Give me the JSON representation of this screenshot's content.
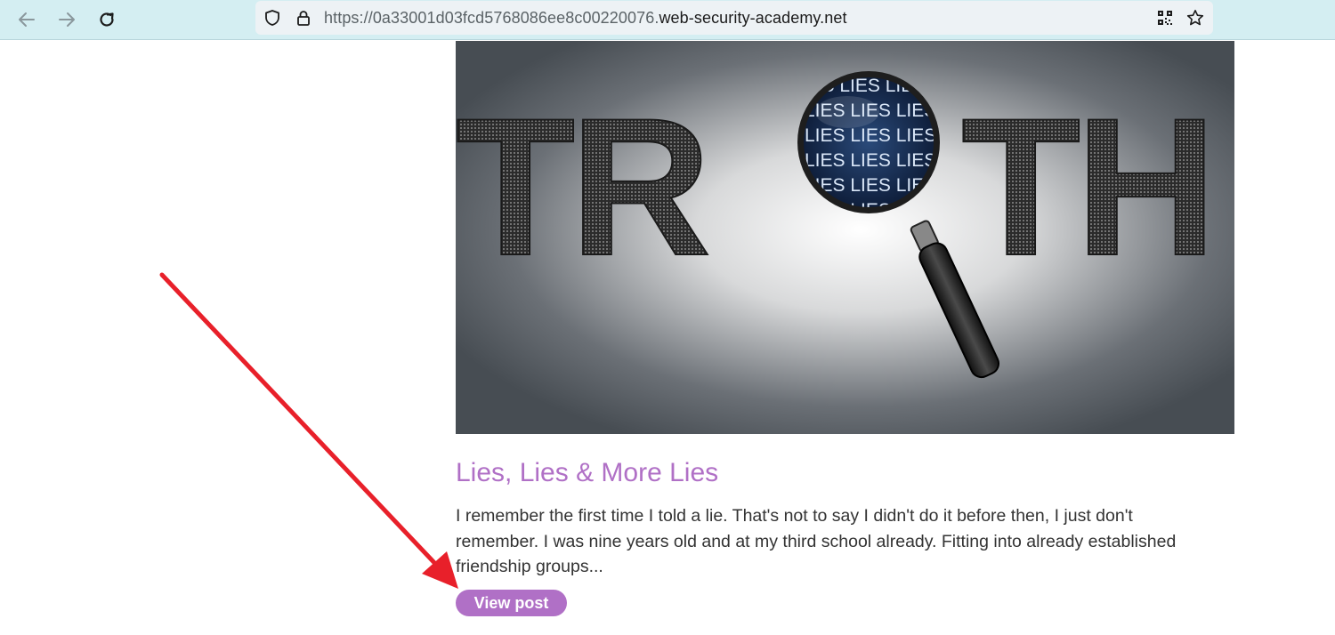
{
  "browser": {
    "url_prefix": "https://0a33001d03fcd5768086ee8c00220076.",
    "url_host": "web-security-academy.net"
  },
  "hero": {
    "word_left": "TR",
    "word_right": "TH",
    "lens_text": "LIES LIES LIES LIES"
  },
  "post": {
    "title": "Lies, Lies & More Lies",
    "excerpt": "I remember the first time I told a lie. That's not to say I didn't do it before then, I just don't remember. I was nine years old and at my third school already. Fitting into already established friendship groups...",
    "button_label": "View post"
  },
  "colors": {
    "accent": "#b070c6",
    "annotation_arrow": "#e8202a",
    "toolbar_bg": "#d4eef2"
  }
}
